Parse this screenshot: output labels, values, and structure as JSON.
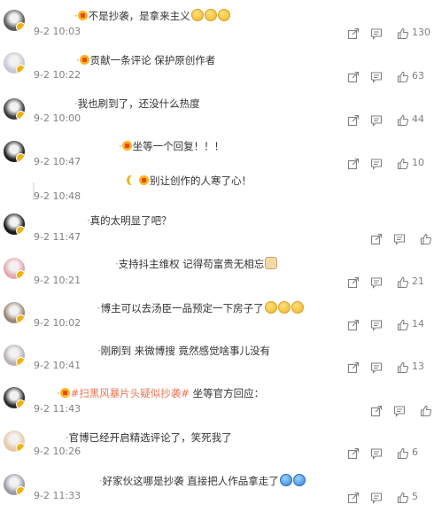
{
  "comments": [
    {
      "segments": [
        {
          "k": "tag",
          "t": "不是抄袭，是拿来主义"
        }
      ],
      "emojis": 3,
      "time": "9-2 10:03",
      "likes": "130"
    },
    {
      "segments": [
        {
          "k": "tag",
          "t": "贡献一条评论 保护原创作者"
        }
      ],
      "emojis": 0,
      "time": "9-2 10:22",
      "likes": "63"
    },
    {
      "segments": [
        {
          "k": "plain",
          "t": "我也刷到了，还没什么热度"
        }
      ],
      "emojis": 0,
      "time": "9-2 10:00",
      "likes": "44"
    },
    {
      "segments": [
        {
          "k": "tag",
          "t": "坐等一个回复！！！"
        }
      ],
      "emojis": 0,
      "time": "9-2 10:47",
      "likes": "10"
    },
    {
      "segments": [
        {
          "k": "tag",
          "t": "别让创作的人寒了心！"
        }
      ],
      "emojis": 0,
      "time": "9-2 10:48",
      "likes": ""
    },
    {
      "segments": [
        {
          "k": "plain",
          "t": "真的太明显了吧？"
        }
      ],
      "emojis": 0,
      "time": "9-2 11:47",
      "likes": ""
    },
    {
      "segments": [
        {
          "k": "plain",
          "t": "支持抖主维权 记得苟富贵无相忘"
        }
      ],
      "emojis": 1,
      "time": "9-2 10:21",
      "likes": "21"
    },
    {
      "segments": [
        {
          "k": "plain",
          "t": "博主可以去汤臣一品预定一下房子了"
        }
      ],
      "emojis": 3,
      "time": "9-2 10:02",
      "likes": "14"
    },
    {
      "segments": [
        {
          "k": "plain",
          "t": "刚刷到 来微博搜 竟然感觉啥事儿没有"
        }
      ],
      "emojis": 0,
      "time": "9-2 10:41",
      "likes": "13"
    },
    {
      "segments": [
        {
          "k": "hl",
          "t": "#扫黑风暴片头疑似抄袭#"
        },
        {
          "k": "plain",
          "t": " 坐等官方回应："
        }
      ],
      "emojis": 0,
      "time": "9-2 11:43",
      "likes": ""
    },
    {
      "segments": [
        {
          "k": "plain",
          "t": "官博已经开启精选评论了，笑死我了"
        }
      ],
      "emojis": 0,
      "time": "9-2 10:26",
      "likes": "6"
    },
    {
      "segments": [
        {
          "k": "plain",
          "t": "好家伙这哪是抄袭 直接把人作品拿走了"
        }
      ],
      "emojis": 2,
      "time": "9-2 11:33",
      "likes": "5"
    }
  ],
  "icons": [
    "share-icon",
    "comment-icon",
    "like-icon"
  ],
  "colors": {
    "accent": "#eb7350",
    "meta": "#808080",
    "text": "#333333"
  }
}
